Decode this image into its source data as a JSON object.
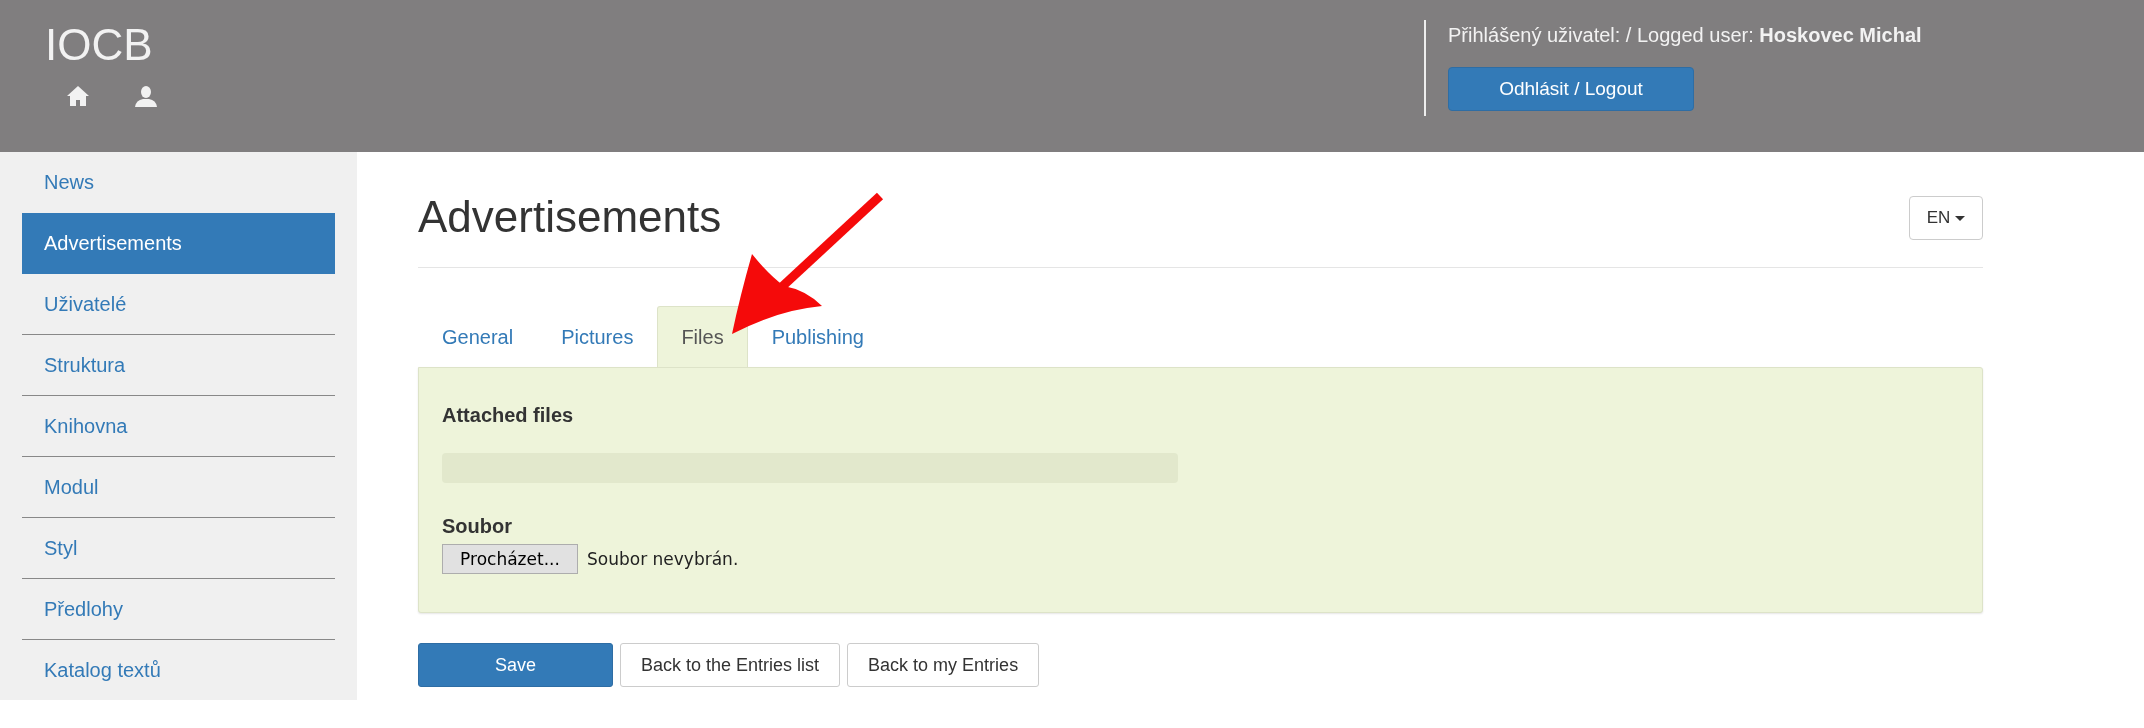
{
  "header": {
    "logo": "IOCB",
    "user_label": "Přihlášený uživatel: / Logged user:",
    "user_name": "Hoskovec Michal",
    "logout": "Odhlásit / Logout"
  },
  "sidebar": {
    "items": [
      {
        "label": "News",
        "selected": false
      },
      {
        "label": "Advertisements",
        "selected": true
      },
      {
        "label": "Uživatelé",
        "selected": false
      },
      {
        "label": "Struktura",
        "selected": false
      },
      {
        "label": "Knihovna",
        "selected": false
      },
      {
        "label": "Modul",
        "selected": false
      },
      {
        "label": "Styl",
        "selected": false
      },
      {
        "label": "Předlohy",
        "selected": false
      },
      {
        "label": "Katalog textů",
        "selected": false
      }
    ]
  },
  "page": {
    "title": "Advertisements",
    "language": "EN"
  },
  "tabs": [
    {
      "label": "General",
      "selected": false
    },
    {
      "label": "Pictures",
      "selected": false
    },
    {
      "label": "Files",
      "selected": true
    },
    {
      "label": "Publishing",
      "selected": false
    }
  ],
  "panel": {
    "attached_label": "Attached files",
    "file_label": "Soubor",
    "browse": "Procházet...",
    "file_status": "Soubor nevybrán."
  },
  "buttons": [
    {
      "label": "Save",
      "kind": "primary"
    },
    {
      "label": "Back to the Entries list",
      "kind": "default"
    },
    {
      "label": "Back to my Entries",
      "kind": "default"
    }
  ]
}
